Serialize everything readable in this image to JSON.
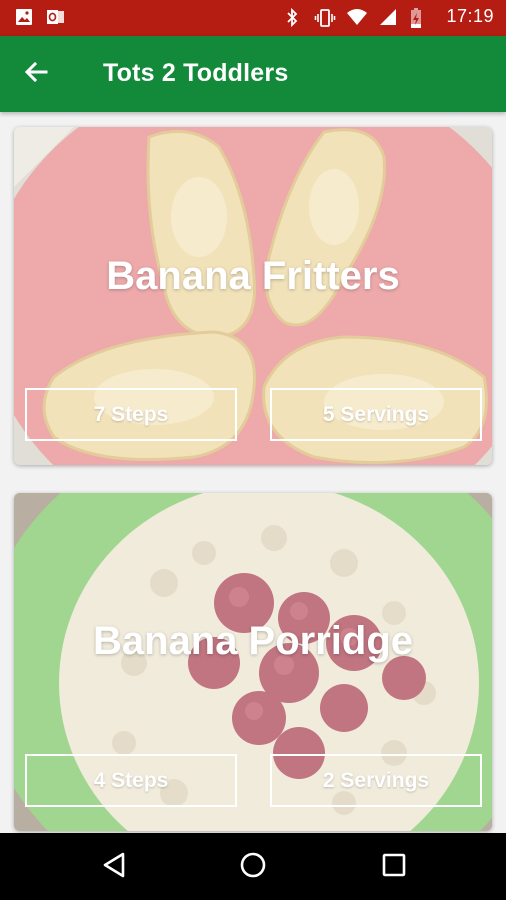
{
  "status_bar": {
    "time": "17:19",
    "left_icons": [
      "image-icon",
      "outlook-icon"
    ],
    "right_icons": [
      "bluetooth-icon",
      "vibrate-icon",
      "wifi-icon",
      "signal-icon",
      "battery-charging-icon"
    ],
    "background": "#b51d12"
  },
  "app_bar": {
    "title": "Tots 2 Toddlers",
    "back_icon": "arrow-back-icon",
    "background": "#128a3a"
  },
  "recipes": [
    {
      "title": "Banana Fritters",
      "steps": "7 Steps",
      "servings": "5 Servings",
      "plate_color": "#e8888a"
    },
    {
      "title": "Banana Porridge",
      "steps": "4 Steps",
      "servings": "2 Servings",
      "plate_color": "#7cc764"
    }
  ],
  "nav_bar": {
    "icons": [
      "nav-back-icon",
      "nav-home-icon",
      "nav-recents-icon"
    ]
  }
}
